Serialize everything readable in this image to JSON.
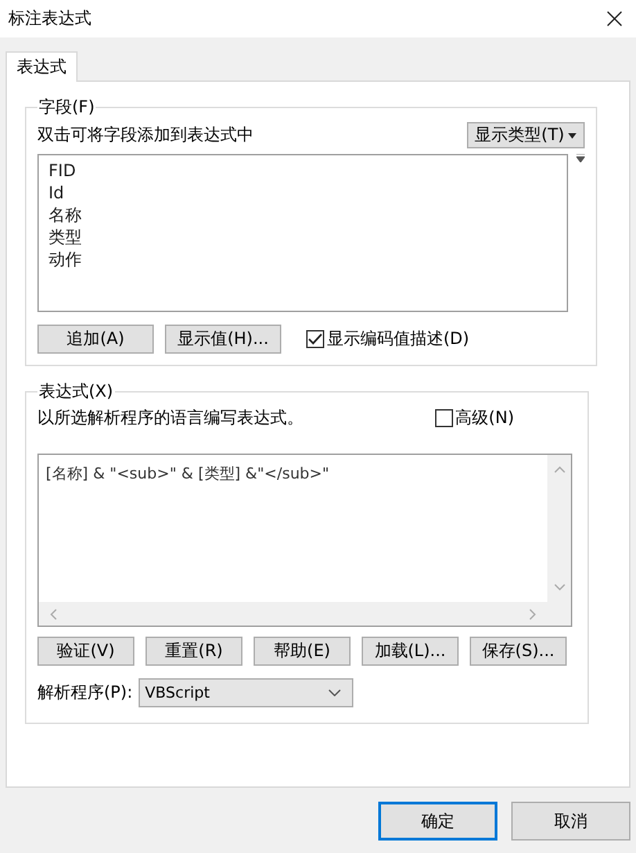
{
  "window": {
    "title": "标注表达式"
  },
  "tabs": [
    {
      "label": "表达式",
      "selected": true
    }
  ],
  "fields_group": {
    "title": "字段(F)",
    "hint": "双击可将字段添加到表达式中",
    "type_button": "显示类型(T)",
    "fields": [
      {
        "name": "FID",
        "selected": false
      },
      {
        "name": "Id",
        "selected": false
      },
      {
        "name": "名称",
        "selected": false
      },
      {
        "name": "类型",
        "selected": false
      },
      {
        "name": "动作",
        "selected": false
      }
    ],
    "buttons": [
      "追加(A)",
      "显示值(H)..."
    ],
    "coded_values": {
      "label": "显示编码值描述(D)",
      "checked": true
    }
  },
  "expression_group": {
    "title": "表达式(X)",
    "hint": "以所选解析程序的语言编写表达式。",
    "advanced": {
      "label": "高级(N)",
      "checked": false
    },
    "expression": "[名称] & \"<sub>\" & [类型] &\"</sub>\"",
    "buttons": [
      "验证(V)",
      "重置(R)",
      "帮助(E)",
      "加载(L)...",
      "保存(S)..."
    ],
    "parser_label": "解析程序(P):",
    "parser": "VBScript"
  },
  "footer_buttons": [
    {
      "label": "确定",
      "default": true
    },
    {
      "label": "取消",
      "default": false
    }
  ]
}
